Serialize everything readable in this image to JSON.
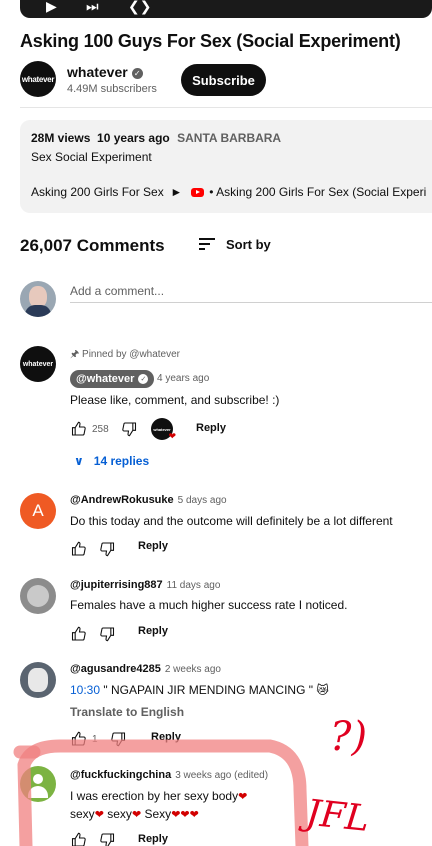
{
  "video": {
    "title": "Asking 100 Guys For Sex (Social Experiment)",
    "channel_name": "whatever",
    "channel_logo_text": "whatever",
    "subscribers": "4.49M subscribers",
    "subscribe_label": "Subscribe"
  },
  "description": {
    "views": "28M views",
    "age": "10 years ago",
    "location": "SANTA BARBARA",
    "line": "Sex Social Experiment",
    "link_prefix": "Asking 200 Girls For Sex",
    "link_text": "• Asking 200 Girls For Sex (Social Experi"
  },
  "comments_header": {
    "count": "26,007 Comments",
    "sort_label": "Sort by",
    "add_placeholder": "Add a comment..."
  },
  "pinned": {
    "pinned_by": "Pinned by @whatever",
    "author": "@whatever",
    "time": "4 years ago",
    "text": "Please like, comment, and subscribe! :)",
    "likes": "258",
    "reply_label": "Reply",
    "replies_label": "14 replies",
    "avatar_text": "whatever"
  },
  "comments": [
    {
      "author": "@AndrewRokusuke",
      "time": "5 days ago",
      "text": "Do this today and the outcome will definitely be a lot different",
      "reply_label": "Reply",
      "avatar_letter": "A",
      "avatar_color": "#ef5a24"
    },
    {
      "author": "@jupiterrising887",
      "time": "11 days ago",
      "text": "Females have a much higher success rate I noticed.",
      "reply_label": "Reply"
    },
    {
      "author": "@agusandre4285",
      "time": "2 weeks ago",
      "timestamp_link": "10:30",
      "text": " \" NGAPAIN JIR MENDING MANCING \" 😿",
      "translate_label": "Translate to English",
      "likes": "1",
      "reply_label": "Reply"
    },
    {
      "author": "@fuckfuckingchina",
      "time": "3 weeks ago (edited)",
      "text_line1": "I was erection by her sexy body",
      "text_line2_a": "sexy",
      "text_line2_b": "sexy",
      "text_line2_c": "Sexy",
      "reply_label": "Reply",
      "avatar_color": "#7cb342"
    }
  ],
  "annotations": {
    "question_marks": "?)",
    "scribble": "JFL",
    "pen_color": "#e00020",
    "highlight_color": "#f08080"
  }
}
